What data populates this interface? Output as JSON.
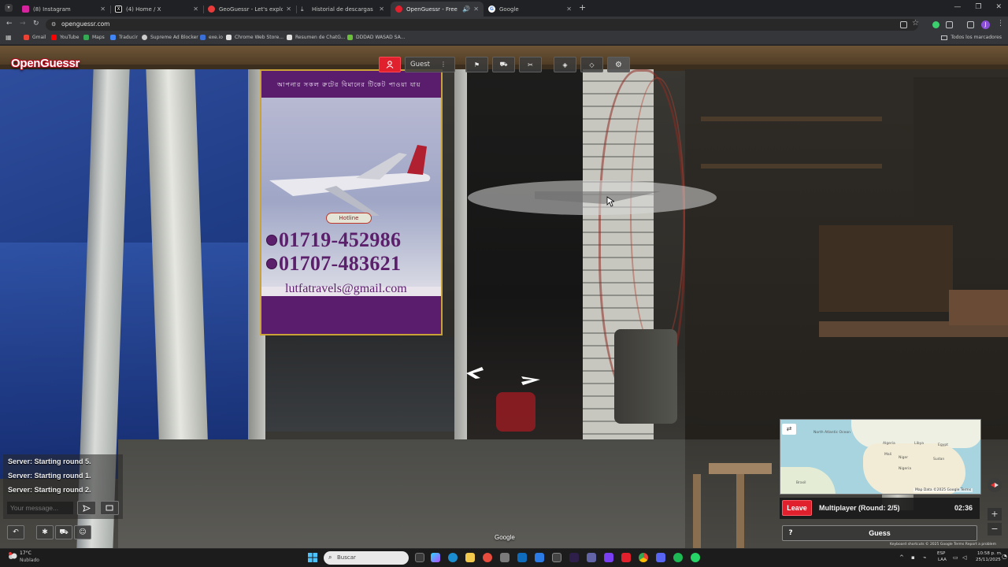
{
  "browser": {
    "tabs": [
      {
        "title": "(8) Instagram",
        "active": false,
        "color": "#d6249f"
      },
      {
        "title": "(4) Home / X",
        "active": false,
        "color": "#ffffff"
      },
      {
        "title": "GeoGuessr - Let's explore the w",
        "active": false,
        "color": "#e83b3b"
      },
      {
        "title": "Historial de descargas",
        "active": false,
        "color": "#c4c7c5"
      },
      {
        "title": "OpenGuessr - Free GeoGue",
        "active": true,
        "color": "#e0202d"
      },
      {
        "title": "Google",
        "active": false,
        "color": "#4285f4"
      }
    ],
    "url": "openguessr.com",
    "profile_initial": "J",
    "bookmarks": [
      {
        "label": "Gmail",
        "color": "#ea4335"
      },
      {
        "label": "YouTube",
        "color": "#ff0000"
      },
      {
        "label": "Maps",
        "color": "#34a853"
      },
      {
        "label": "Traducir",
        "color": "#4285f4"
      },
      {
        "label": "Supreme Ad Blocker",
        "color": "#cccccc"
      },
      {
        "label": "exe.io",
        "color": "#3b6fd8"
      },
      {
        "label": "Chrome Web Store...",
        "color": "#e0e0e0"
      },
      {
        "label": "Resumen de ChatG...",
        "color": "#e0e0e0"
      },
      {
        "label": "DDDAD WASAD SA...",
        "color": "#6bbf3a"
      }
    ],
    "all_bookmarks_label": "Todos los marcadores"
  },
  "game": {
    "logo": "OpenGuessr",
    "guest_name": "Guest",
    "guest_menu": "⋮",
    "chat": {
      "messages": [
        "Server: Starting round 5.",
        "Server: Starting round 1.",
        "Server: Starting round 2."
      ],
      "input_placeholder": "Your message..."
    },
    "leave_label": "Leave",
    "round_label": "Multiplayer (Round: 2/5)",
    "timer": "02:36",
    "help_label": "?",
    "guess_label": "Guess",
    "map": {
      "labels": [
        "North Atlantic Ocean",
        "Brasil",
        "Mali",
        "Niger",
        "Sudan",
        "Libya",
        "Egypt",
        "Algeria",
        "Nigeria"
      ],
      "attribution": "Map Data ©2025 Google   Terms"
    },
    "streetview_watermark": "Google",
    "streetview_attribution": "Keyboard shortcuts   © 2025 Google   Terms   Report a problem"
  },
  "poster": {
    "banner_text": "আপনার সকল রুটের বিমানের টিকেট পাওয়া যায়",
    "hotline": "Hotline",
    "phone1": "01719-452986",
    "phone2": "01707-483621",
    "email": "lutfatravels@gmail.com"
  },
  "taskbar": {
    "weather_temp": "17°C",
    "weather_desc": "Nublado",
    "search_placeholder": "Buscar",
    "lang_line1": "ESP",
    "lang_line2": "LAA",
    "time": "10:58 p. m.",
    "date": "25/11/2025"
  }
}
